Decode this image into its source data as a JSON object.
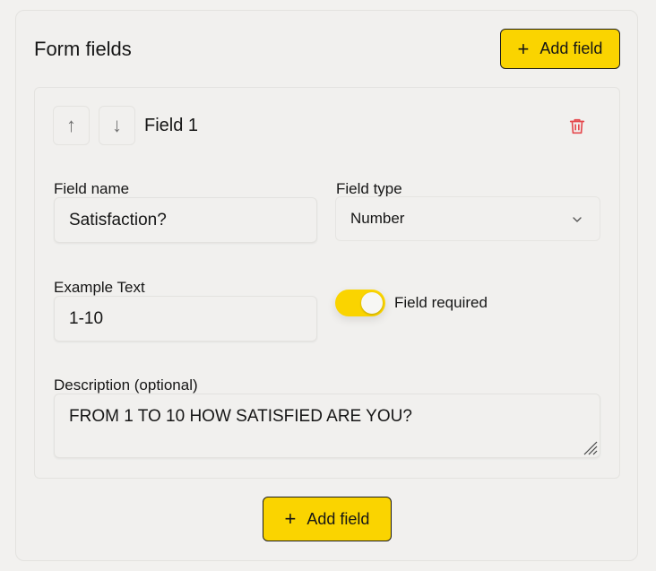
{
  "panel": {
    "title": "Form fields",
    "add_field_top_label": "Add field",
    "add_field_bottom_label": "Add field"
  },
  "field": {
    "title": "Field 1",
    "move_up_icon": "arrow-up-icon",
    "move_down_icon": "arrow-down-icon",
    "delete_icon": "trash-icon",
    "name_label": "Field name",
    "name_value": "Satisfaction?",
    "type_label": "Field type",
    "type_value": "Number",
    "example_label": "Example Text",
    "example_value": "1-10",
    "required_label": "Field required",
    "required_on": true,
    "description_label": "Description (optional)",
    "description_value": "FROM 1 TO 10 HOW SATISFIED ARE YOU?"
  },
  "colors": {
    "accent": "#fad400",
    "danger": "#e5484d",
    "background": "#f2f1ef"
  }
}
